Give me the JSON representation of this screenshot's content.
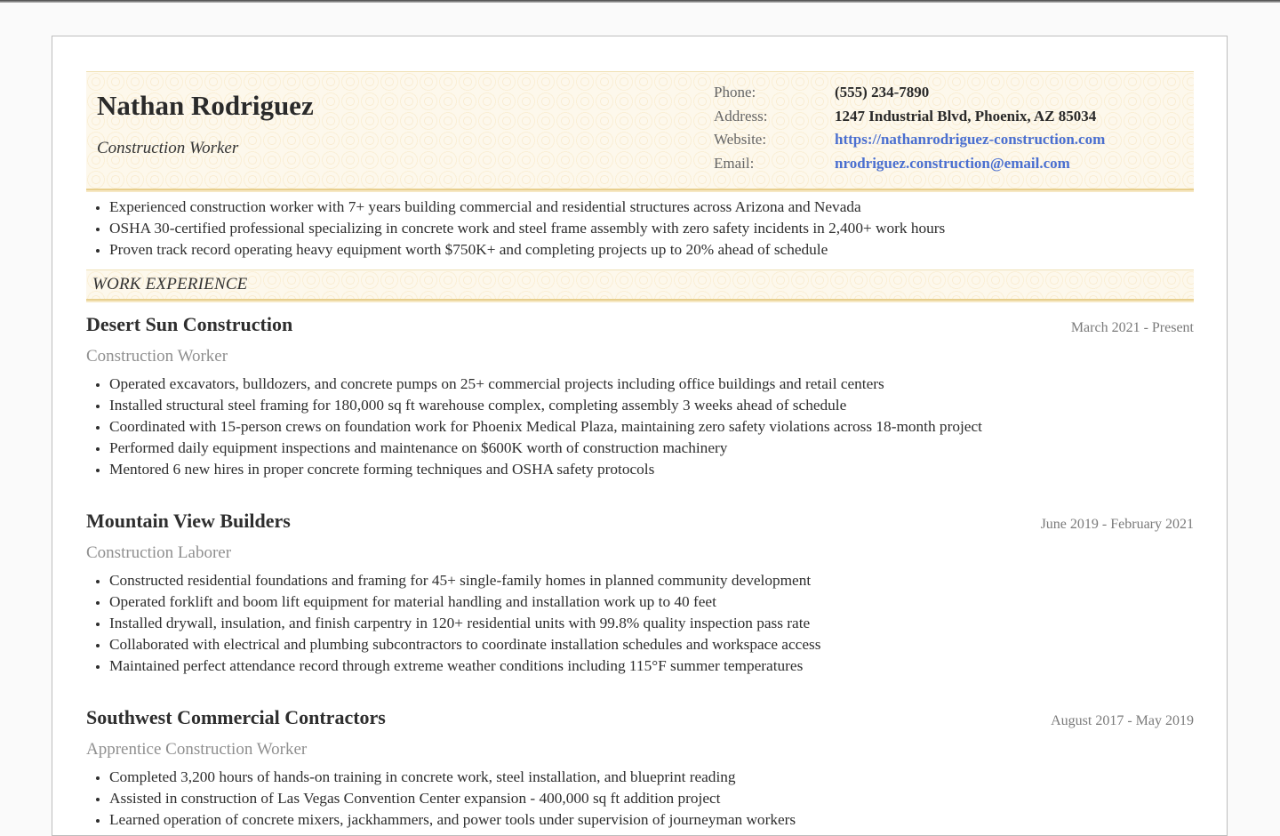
{
  "header": {
    "name": "Nathan Rodriguez",
    "title": "Construction Worker",
    "contact": {
      "phone_label": "Phone:",
      "phone": "(555) 234-7890",
      "address_label": "Address:",
      "address": "1247 Industrial Blvd, Phoenix, AZ 85034",
      "website_label": "Website:",
      "website": "https://nathanrodriguez-construction.com",
      "email_label": "Email:",
      "email": "nrodriguez.construction@email.com"
    }
  },
  "summary": [
    "Experienced construction worker with 7+ years building commercial and residential structures across Arizona and Nevada",
    "OSHA 30-certified professional specializing in concrete work and steel frame assembly with zero safety incidents in 2,400+ work hours",
    "Proven track record operating heavy equipment worth $750K+ and completing projects up to 20% ahead of schedule"
  ],
  "work_experience": {
    "heading": "WORK EXPERIENCE",
    "jobs": [
      {
        "company": "Desert Sun Construction",
        "dates": "March 2021 - Present",
        "role": "Construction Worker",
        "bullets": [
          "Operated excavators, bulldozers, and concrete pumps on 25+ commercial projects including office buildings and retail centers",
          "Installed structural steel framing for 180,000 sq ft warehouse complex, completing assembly 3 weeks ahead of schedule",
          "Coordinated with 15-person crews on foundation work for Phoenix Medical Plaza, maintaining zero safety violations across 18-month project",
          "Performed daily equipment inspections and maintenance on $600K worth of construction machinery",
          "Mentored 6 new hires in proper concrete forming techniques and OSHA safety protocols"
        ]
      },
      {
        "company": "Mountain View Builders",
        "dates": "June 2019 - February 2021",
        "role": "Construction Laborer",
        "bullets": [
          "Constructed residential foundations and framing for 45+ single-family homes in planned community development",
          "Operated forklift and boom lift equipment for material handling and installation work up to 40 feet",
          "Installed drywall, insulation, and finish carpentry in 120+ residential units with 99.8% quality inspection pass rate",
          "Collaborated with electrical and plumbing subcontractors to coordinate installation schedules and workspace access",
          "Maintained perfect attendance record through extreme weather conditions including 115°F summer temperatures"
        ]
      },
      {
        "company": "Southwest Commercial Contractors",
        "dates": "August 2017 - May 2019",
        "role": "Apprentice Construction Worker",
        "bullets": [
          "Completed 3,200 hours of hands-on training in concrete work, steel installation, and blueprint reading",
          "Assisted in construction of Las Vegas Convention Center expansion - 400,000 sq ft addition project",
          "Learned operation of concrete mixers, jackhammers, and power tools under supervision of journeyman workers"
        ]
      }
    ]
  }
}
